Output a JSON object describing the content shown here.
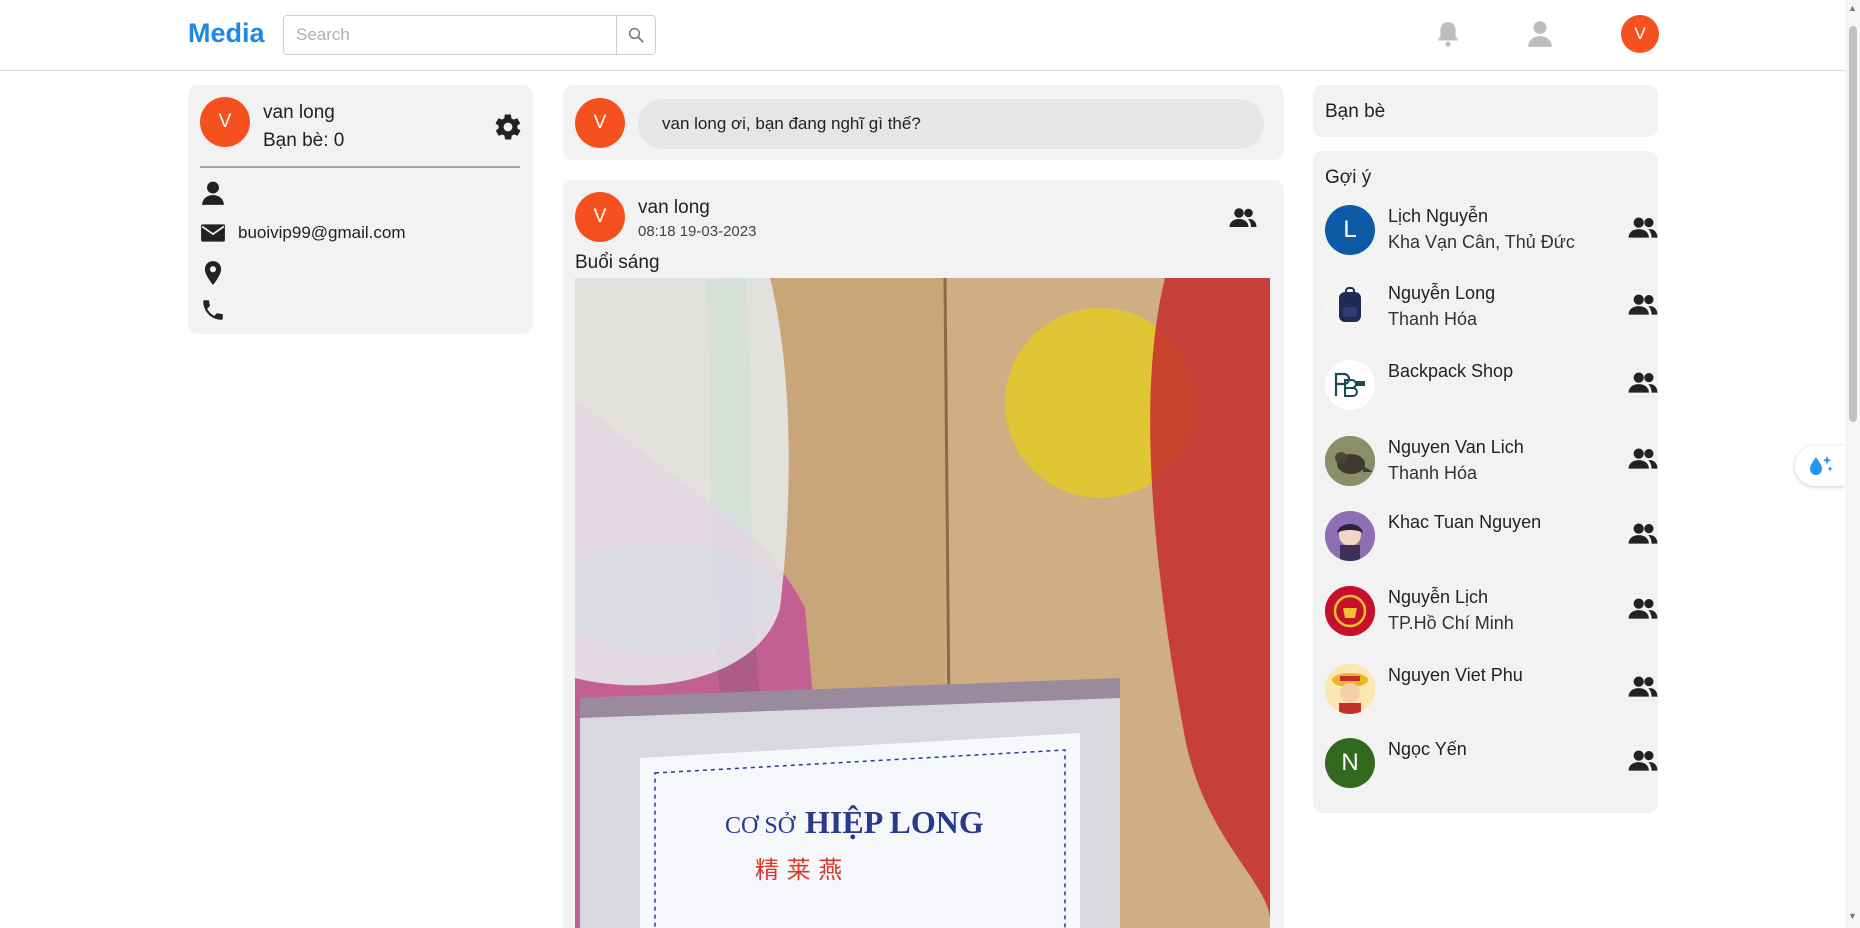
{
  "header": {
    "brand": "Media",
    "search_placeholder": "Search",
    "avatar_initial": "V"
  },
  "profile": {
    "avatar_initial": "V",
    "name": "van long",
    "friends": "Bạn bè: 0",
    "email": "buoivip99@gmail.com"
  },
  "composer": {
    "avatar_initial": "V",
    "prompt": "van long ơi, bạn đang nghĩ gì thế?"
  },
  "post": {
    "avatar_initial": "V",
    "author": "van long",
    "timestamp": "08:18 19-03-2023",
    "text": "Buổi sáng",
    "photo_label_main": "HIỆP LONG",
    "photo_label_prefix": "CƠ SỞ",
    "photo_label_chinese": "精 莱 燕"
  },
  "friends_panel": {
    "title": "Bạn bè"
  },
  "suggestions": {
    "title": "Gợi ý",
    "items": [
      {
        "name": "Lịch Nguyễn",
        "sub": "Kha Vạn Cân, Thủ Đức",
        "initial": "L",
        "color": "#0d5aa7"
      },
      {
        "name": "Nguyễn Long",
        "sub": "Thanh Hóa",
        "initial": "",
        "color": "#ffffff"
      },
      {
        "name": "Backpack Shop",
        "sub": "",
        "initial": "",
        "color": "#ffffff"
      },
      {
        "name": "Nguyen Van Lich",
        "sub": "Thanh Hóa",
        "initial": "",
        "color": "#5a5a48"
      },
      {
        "name": "Khac Tuan Nguyen",
        "sub": "",
        "initial": "",
        "color": "#7c5a9c"
      },
      {
        "name": "Nguyễn Lịch",
        "sub": "TP.Hồ Chí Minh",
        "initial": "",
        "color": "#c8102e"
      },
      {
        "name": "Nguyen Viet Phu",
        "sub": "",
        "initial": "",
        "color": "#f3c84a"
      },
      {
        "name": "Ngọc Yến",
        "sub": "",
        "initial": "N",
        "color": "#33691e"
      }
    ]
  },
  "colors": {
    "brand": "#1e88e5",
    "avatar": "#f4511e",
    "card": "#f2f2f2"
  }
}
